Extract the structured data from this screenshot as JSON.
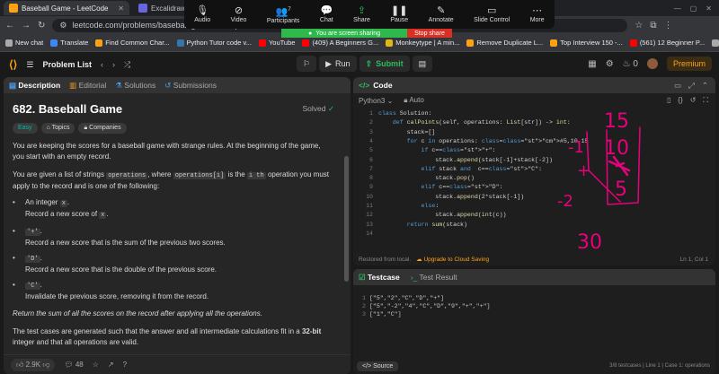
{
  "browser": {
    "tabs": [
      {
        "title": "Baseball Game - LeetCode",
        "color": "#ffa116"
      },
      {
        "title": "Excalidraw",
        "color": "#6965db"
      }
    ],
    "url": "leetcode.com/problems/baseball-game/description/",
    "bookmarks": [
      {
        "label": "New chat",
        "color": "#aaa"
      },
      {
        "label": "Translate",
        "color": "#4285f4"
      },
      {
        "label": "Find Common Char...",
        "color": "#ffa116"
      },
      {
        "label": "Python Tutor code v...",
        "color": "#3776ab"
      },
      {
        "label": "YouTube",
        "color": "#ff0000"
      },
      {
        "label": "(409) A Beginners G...",
        "color": "#ff0000"
      },
      {
        "label": "Monkeytype | A min...",
        "color": "#e2b714"
      },
      {
        "label": "Remove Duplicate L...",
        "color": "#ffa116"
      },
      {
        "label": "Top Interview 150 -...",
        "color": "#ffa116"
      },
      {
        "label": "(561) 12 Beginner P...",
        "color": "#ff0000"
      },
      {
        "label": "All Bookmarks",
        "color": "#aaa"
      }
    ]
  },
  "zoom": {
    "items": [
      {
        "label": "Audio",
        "icon": "mic-icon",
        "glyph": "🎙"
      },
      {
        "label": "Video",
        "icon": "video-off-icon",
        "glyph": "⊘"
      },
      {
        "label": "Participants",
        "icon": "participants-icon",
        "glyph": "👥",
        "badge": "7"
      },
      {
        "label": "Chat",
        "icon": "chat-icon",
        "glyph": "💬"
      },
      {
        "label": "Share",
        "icon": "share-icon",
        "glyph": "⇪"
      },
      {
        "label": "Pause",
        "icon": "pause-icon",
        "glyph": "❚❚"
      },
      {
        "label": "Annotate",
        "icon": "annotate-icon",
        "glyph": "✎"
      },
      {
        "label": "Slide Control",
        "icon": "slide-control-icon",
        "glyph": "▭"
      },
      {
        "label": "More",
        "icon": "more-icon",
        "glyph": "⋯"
      }
    ],
    "sharing_text": "You are screen sharing",
    "stop_text": "Stop share"
  },
  "header": {
    "problem_list": "Problem List",
    "run": "Run",
    "submit": "Submit",
    "streak": "0",
    "premium": "Premium"
  },
  "description": {
    "tabs": [
      "Description",
      "Editorial",
      "Solutions",
      "Submissions"
    ],
    "title": "682. Baseball Game",
    "solved": "Solved",
    "chips": [
      "Easy",
      "Topics",
      "Companies"
    ],
    "p1": "You are keeping the scores for a baseball game with strange rules. At the beginning of the game, you start with an empty record.",
    "p2_a": "You are given a list of strings",
    "p2_code1": "operations",
    "p2_b": ", where",
    "p2_code2": "operations[i]",
    "p2_c": "is the",
    "p2_code3": "i th",
    "p2_d": "operation you must apply to the record and is one of the following:",
    "ops": [
      {
        "head": "An integer",
        "code": "x",
        "desc_a": "Record a new score of",
        "desc_code": "x"
      },
      {
        "code": "'+'",
        "desc": "Record a new score that is the sum of the previous two scores."
      },
      {
        "code": "'D'",
        "desc": "Record a new score that is the double of the previous score."
      },
      {
        "code": "'C'",
        "desc": "Invalidate the previous score, removing it from the record."
      }
    ],
    "p3": "Return the sum of all the scores on the record after applying all the operations.",
    "p4_a": "The test cases are generated such that the answer and all intermediate calculations fit in a",
    "p4_bold": "32-bit",
    "p4_b": "integer and that all operations are valid.",
    "likes": "2.9K",
    "comments": "48"
  },
  "code": {
    "title": "Code",
    "language": "Python3",
    "mode": "Auto",
    "lines": [
      {
        "n": "1",
        "text": "class Solution:"
      },
      {
        "n": "2",
        "text": "    def calPoints(self, operations: List[str]) -> int:"
      },
      {
        "n": "3",
        "text": "        stack=[]"
      },
      {
        "n": "4",
        "text": "        for c in operations: #5,10,15"
      },
      {
        "n": "5",
        "text": "            if c==\"+\":"
      },
      {
        "n": "6",
        "text": "                stack.append(stack[-1]+stack[-2])"
      },
      {
        "n": "7",
        "text": "            elif stack and  c==\"C\":"
      },
      {
        "n": "8",
        "text": "                stack.pop()"
      },
      {
        "n": "9",
        "text": "            elif c==\"D\":"
      },
      {
        "n": "10",
        "text": "                stack.append(2*stack[-1])"
      },
      {
        "n": "11",
        "text": "            else:"
      },
      {
        "n": "12",
        "text": "                stack.append(int(c))"
      },
      {
        "n": "13",
        "text": "        return sum(stack)"
      },
      {
        "n": "14",
        "text": ""
      }
    ],
    "restored": "Restored from local.",
    "upgrade": "Upgrade to Cloud Saving",
    "position": "Ln 1, Col 1"
  },
  "annotations": {
    "numbers": [
      "15",
      "10",
      "5",
      "-1",
      "+",
      "-2",
      "30"
    ],
    "color": "#e8007d"
  },
  "testcase": {
    "tabs": [
      "Testcase",
      "Test Result"
    ],
    "lines": [
      {
        "n": "1",
        "text": "[\"5\",\"2\",\"C\",\"D\",\"+\"]"
      },
      {
        "n": "2",
        "text": "[\"5\",\"-2\",\"4\",\"C\",\"D\",\"9\",\"+\",\"+\"]"
      },
      {
        "n": "3",
        "text": "[\"1\",\"C\"]"
      }
    ],
    "source": "Source",
    "footer_right": "3/8 testcases  |  Line 1  |  Case 1: operations"
  }
}
